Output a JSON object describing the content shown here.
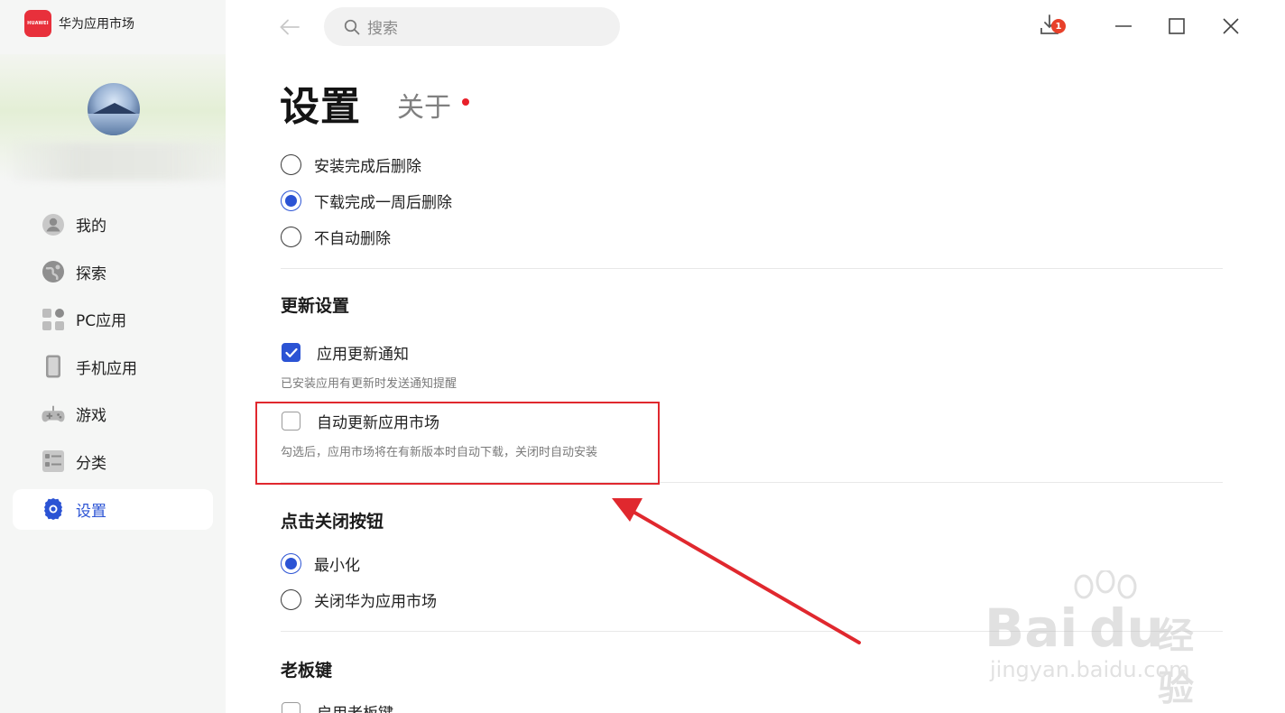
{
  "app": {
    "name": "华为应用市场",
    "logo_text": "HUAWEI"
  },
  "sidebar": {
    "items": [
      {
        "label": "我的",
        "icon": "user-icon"
      },
      {
        "label": "探索",
        "icon": "planet-icon"
      },
      {
        "label": "PC应用",
        "icon": "apps-grid-icon"
      },
      {
        "label": "手机应用",
        "icon": "phone-icon"
      },
      {
        "label": "游戏",
        "icon": "gamepad-icon"
      },
      {
        "label": "分类",
        "icon": "category-list-icon"
      },
      {
        "label": "设置",
        "icon": "gear-icon",
        "active": true
      }
    ]
  },
  "topbar": {
    "search_placeholder": "搜索",
    "download_badge": "1"
  },
  "page": {
    "title": "设置",
    "about_tab": "关于"
  },
  "delete_options": [
    {
      "label": "安装完成后删除",
      "selected": false
    },
    {
      "label": "下载完成一周后删除",
      "selected": true
    },
    {
      "label": "不自动删除",
      "selected": false
    }
  ],
  "update_settings": {
    "title": "更新设置",
    "notify_label": "应用更新通知",
    "notify_checked": true,
    "notify_help": "已安装应用有更新时发送通知提醒",
    "auto_update_label": "自动更新应用市场",
    "auto_update_checked": false,
    "auto_update_help": "勾选后，应用市场将在有新版本时自动下载，关闭时自动安装"
  },
  "close_button": {
    "title": "点击关闭按钮",
    "options": [
      {
        "label": "最小化",
        "selected": true
      },
      {
        "label": "关闭华为应用市场",
        "selected": false
      }
    ]
  },
  "boss_key": {
    "title": "老板键",
    "enable_label": "启用老板键"
  },
  "watermark": {
    "brand": "Bai",
    "brand2": "du",
    "cn": "经验",
    "url": "jingyan.baidu.com"
  },
  "colors": {
    "accent": "#2b53d4",
    "brand_red": "#e8303b",
    "annotation_red": "#e0282e"
  }
}
